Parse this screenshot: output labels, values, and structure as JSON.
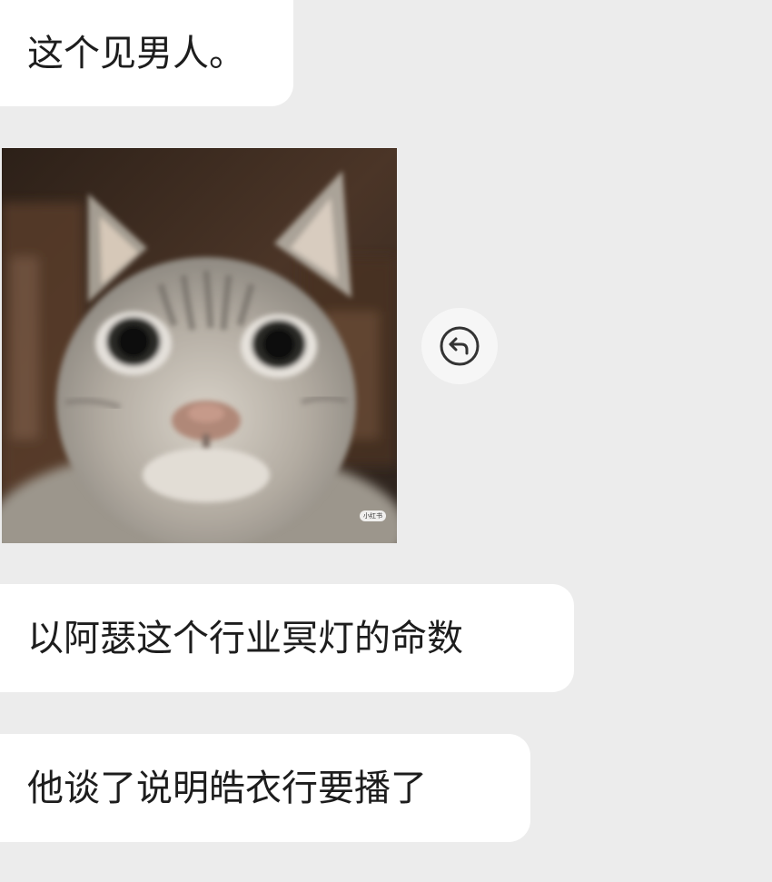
{
  "messages": [
    {
      "type": "text",
      "text": "这个见男人。"
    },
    {
      "type": "image",
      "subject": "cat-face-photo",
      "watermark": "小红书"
    },
    {
      "type": "text",
      "text": "以阿瑟这个行业冥灯的命数"
    },
    {
      "type": "text",
      "text": "他谈了说明皓衣行要播了"
    }
  ],
  "reply_button": {
    "icon": "reply-arrow-icon"
  },
  "colors": {
    "background": "#ececec",
    "bubble": "#ffffff",
    "text": "#1d1d1d",
    "reply_button_bg": "#f6f6f6",
    "reply_icon": "#333333"
  }
}
